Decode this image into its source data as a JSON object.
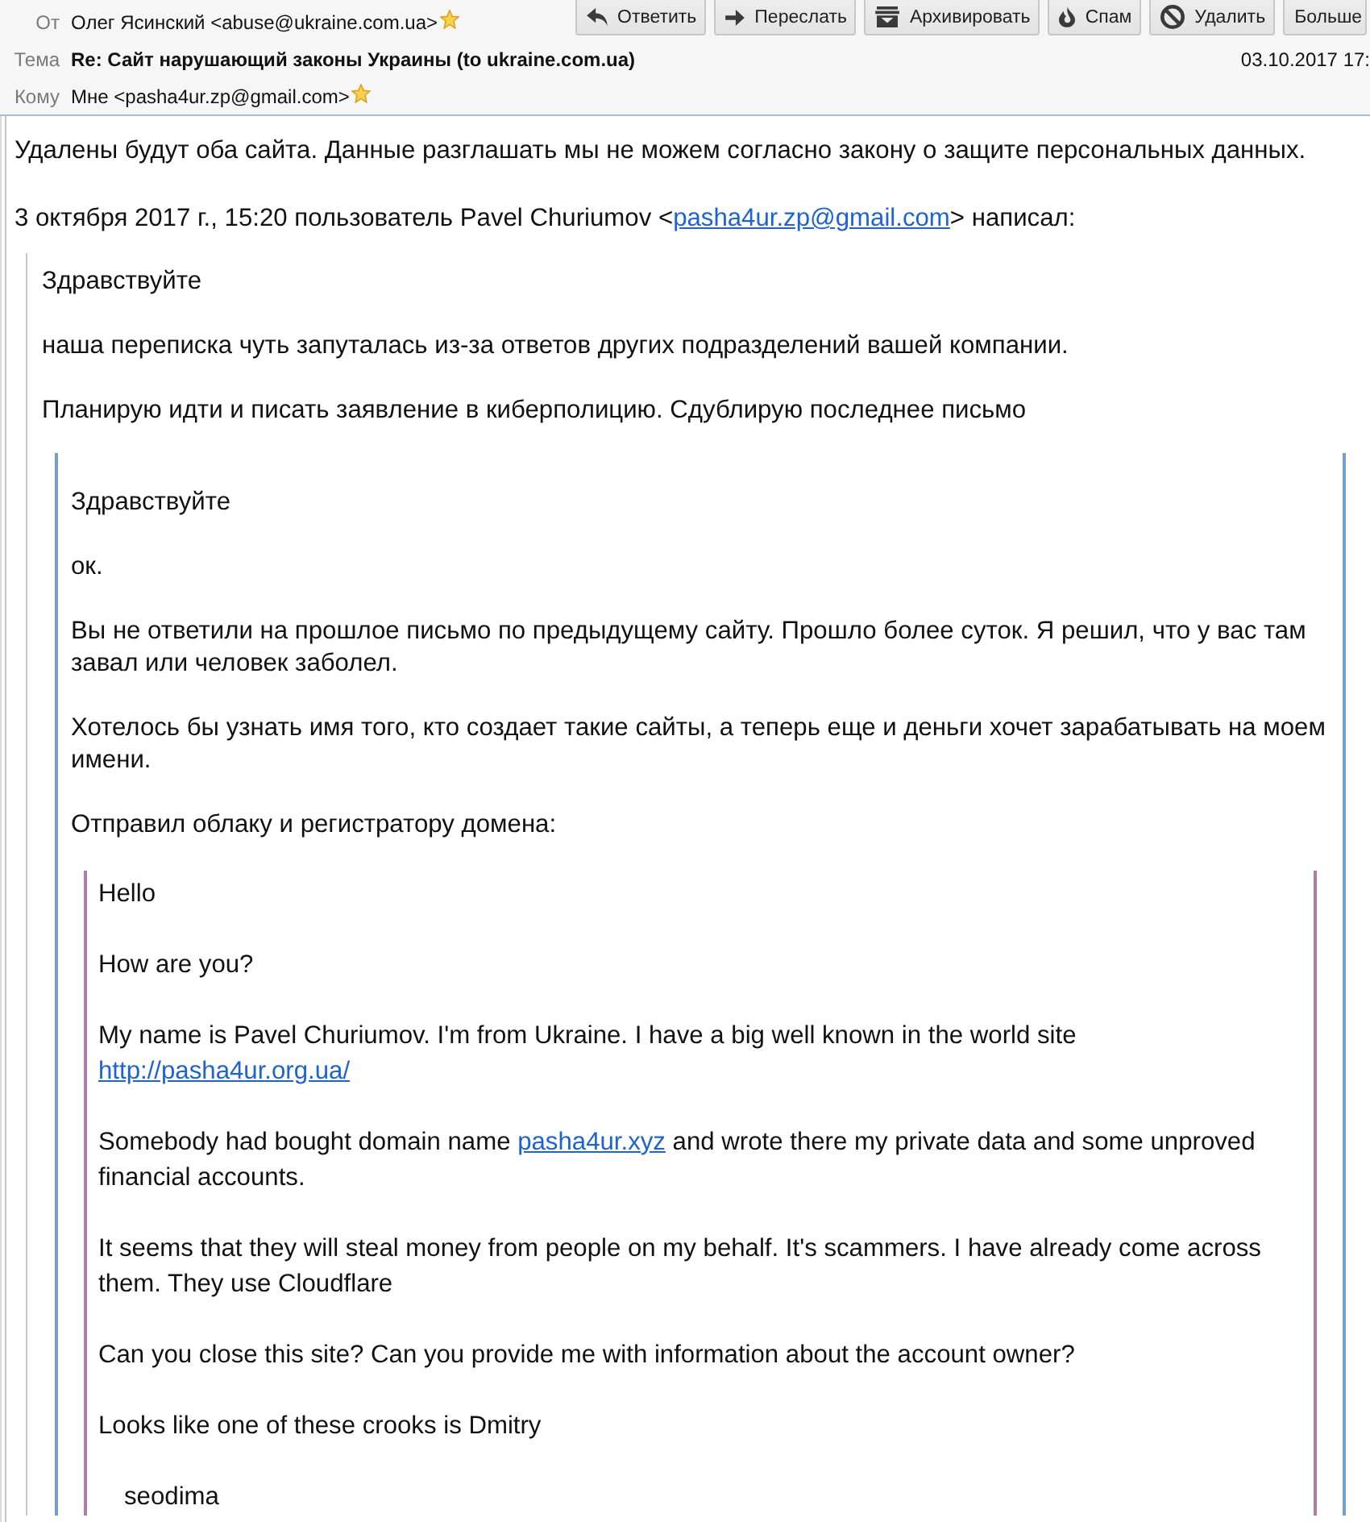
{
  "toolbar": {
    "buttons": [
      {
        "kind": "reply",
        "label": "Ответить"
      },
      {
        "kind": "forward",
        "label": "Переслать"
      },
      {
        "kind": "archive",
        "label": "Архивировать"
      },
      {
        "kind": "spam",
        "label": "Спам"
      },
      {
        "kind": "delete",
        "label": "Удалить"
      },
      {
        "kind": "more",
        "label": "Больше"
      }
    ]
  },
  "header": {
    "fields": [
      {
        "kind": "address",
        "label": "От",
        "value": "Олег Ясинский <abuse@ukraine.com.ua>"
      },
      {
        "kind": "subject",
        "label": "Тема",
        "value": "Re: Сайт нарушающий законы Украины (to ukraine.com.ua)"
      },
      {
        "kind": "address",
        "label": "Кому",
        "value": "Мне <pasha4ur.zp@gmail.com>"
      }
    ],
    "date": "03.10.2017 17:"
  },
  "message": {
    "blocks": [
      {
        "kind": "paragraph",
        "text": "Удалены будут оба сайта. Данные разглашать мы не можем согласно закону о защите персональных данных."
      },
      {
        "kind": "paragraph",
        "parts": [
          {
            "kind": "text",
            "text": "3 октября 2017 г., 15:20 пользователь Pavel Churiumov <"
          },
          {
            "kind": "link",
            "text": "pasha4ur.zp@gmail.com"
          },
          {
            "kind": "text",
            "text": "> написал:"
          }
        ]
      },
      {
        "kind": "quote",
        "blocks": [
          {
            "kind": "paragraph",
            "text": "Здравствуйте"
          },
          {
            "kind": "paragraph",
            "text": "наша переписка чуть запуталась из-за ответов других подразделений вашей компании."
          },
          {
            "kind": "paragraph",
            "text": "Планирую идти и писать заявление в киберполицию. Сдублирую последнее письмо"
          },
          {
            "kind": "quote",
            "blocks": [
              {
                "kind": "paragraph",
                "text": "Здравствуйте"
              },
              {
                "kind": "paragraph",
                "text": "ок."
              },
              {
                "kind": "paragraph",
                "text": "Вы не ответили на прошлое письмо по предыдущему сайту. Прошло более суток. Я решил, что у вас там завал или человек заболел."
              },
              {
                "kind": "paragraph",
                "text": "Хотелось бы узнать имя того, кто создает такие сайты, а теперь еще и деньги хочет зарабатывать на моем имени."
              },
              {
                "kind": "paragraph",
                "text": "Отправил облаку и регистратору домена:"
              },
              {
                "kind": "quote",
                "blocks": [
                  {
                    "kind": "paragraph",
                    "text": "Hello"
                  },
                  {
                    "kind": "paragraph",
                    "text": "How are you?"
                  },
                  {
                    "kind": "paragraph",
                    "parts": [
                      {
                        "kind": "text",
                        "text": "My name is Pavel Churiumov. I'm from Ukraine. I have a big well known in the world site "
                      },
                      {
                        "kind": "link",
                        "text": "http://pasha4ur.org.ua/"
                      }
                    ]
                  },
                  {
                    "kind": "paragraph",
                    "parts": [
                      {
                        "kind": "text",
                        "text": "Somebody had bought domain name "
                      },
                      {
                        "kind": "link",
                        "text": "pasha4ur.xyz"
                      },
                      {
                        "kind": "text",
                        "text": " and wrote there my private data and some unproved financial accounts."
                      }
                    ]
                  },
                  {
                    "kind": "paragraph",
                    "text": "It seems that they will steal money from people on my behalf. It's scammers. I have already come across them. They use Cloudflare"
                  },
                  {
                    "kind": "paragraph",
                    "text": "Can you close this site? Can you provide me with information about the account owner?"
                  },
                  {
                    "kind": "paragraph",
                    "text": "Looks like one of these crooks is Dmitry"
                  },
                  {
                    "kind": "indented",
                    "text": "seodima"
                  }
                ]
              }
            ]
          }
        ]
      }
    ]
  }
}
